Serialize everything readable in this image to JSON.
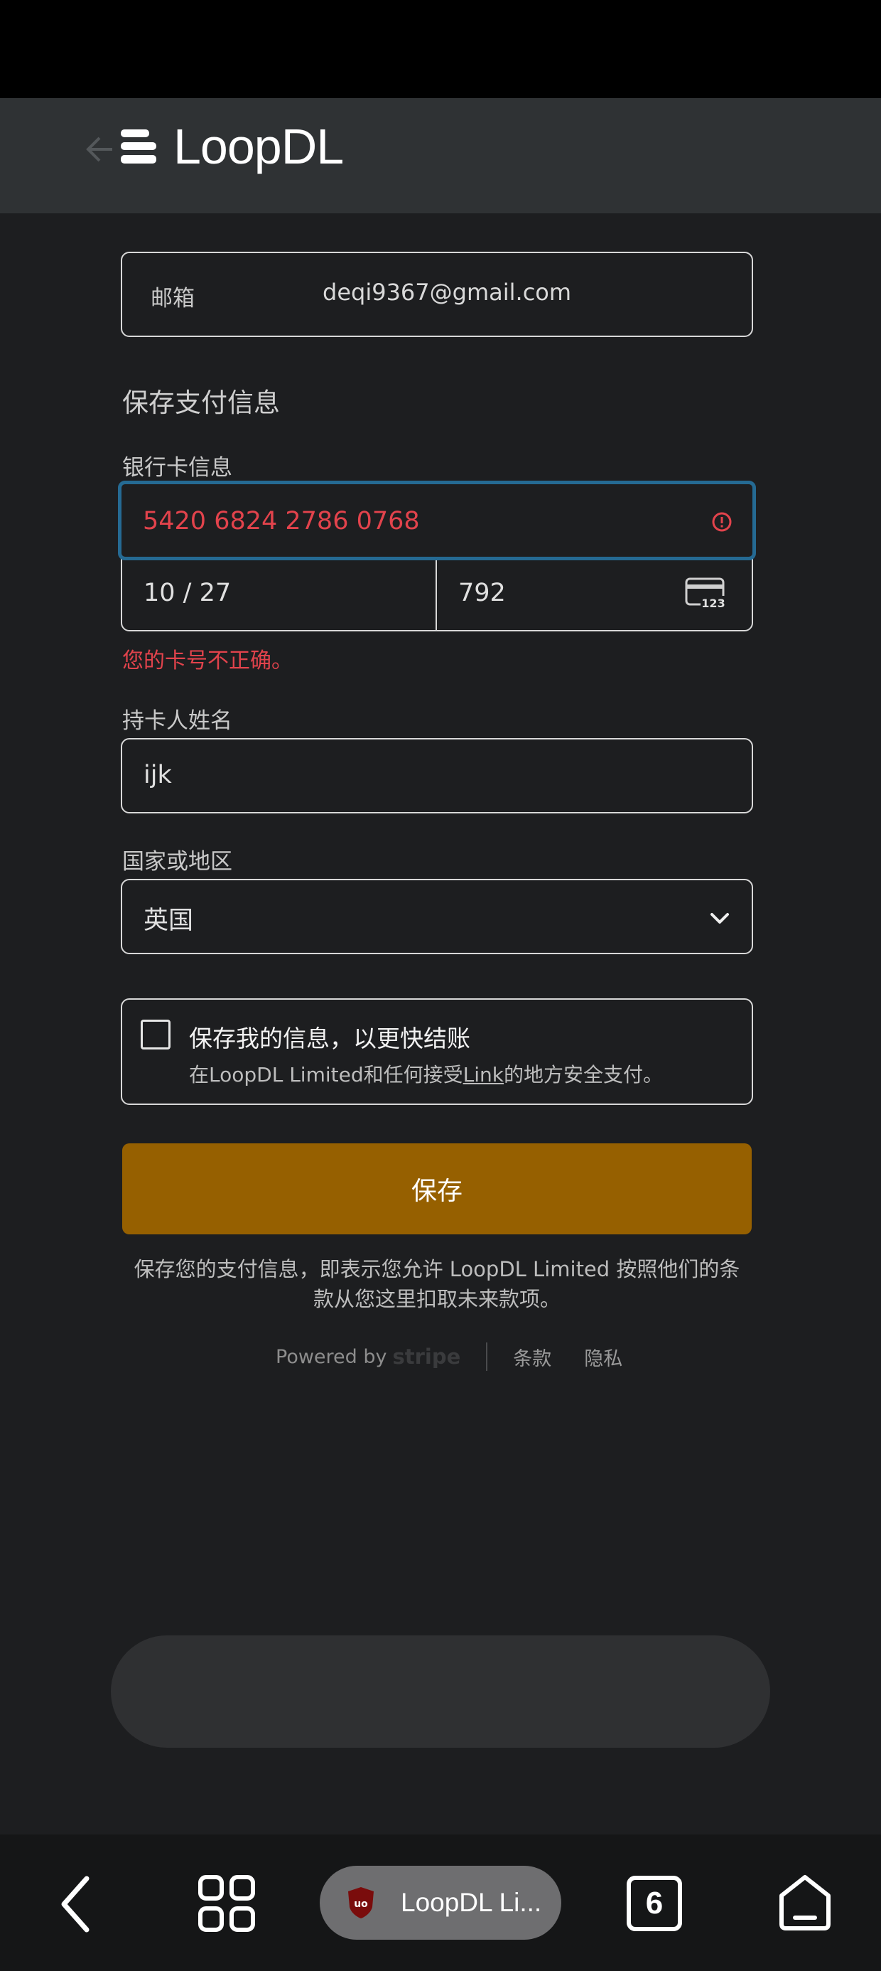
{
  "header": {
    "brand": "LoopDL"
  },
  "email": {
    "label": "邮箱",
    "value": "deqi9367@gmail.com"
  },
  "payment": {
    "section_title": "保存支付信息",
    "card_label": "银行卡信息",
    "card_number": "5420 6824 2786 0768",
    "expiry": "10 / 27",
    "cvc": "792",
    "error": "您的卡号不正确。"
  },
  "cardholder": {
    "label": "持卡人姓名",
    "value": "ijk"
  },
  "country": {
    "label": "国家或地区",
    "value": "英国"
  },
  "save_info": {
    "title": "保存我的信息，以更快结账",
    "sub_prefix": "在LoopDL Limited和任何接受",
    "sub_link": "Link",
    "sub_suffix": "的地方安全支付。"
  },
  "save_button": "保存",
  "terms_text": "保存您的支付信息，即表示您允许 LoopDL Limited 按照他们的条款从您这里扣取未来款项。",
  "footer": {
    "powered_by": "Powered by",
    "stripe": "stripe",
    "terms": "条款",
    "privacy": "隐私"
  },
  "nav": {
    "tab_label": "LoopDL Li...",
    "tabs_count": "6"
  },
  "colors": {
    "accent": "#966000",
    "error": "#e2434c",
    "focus": "#256a93"
  }
}
